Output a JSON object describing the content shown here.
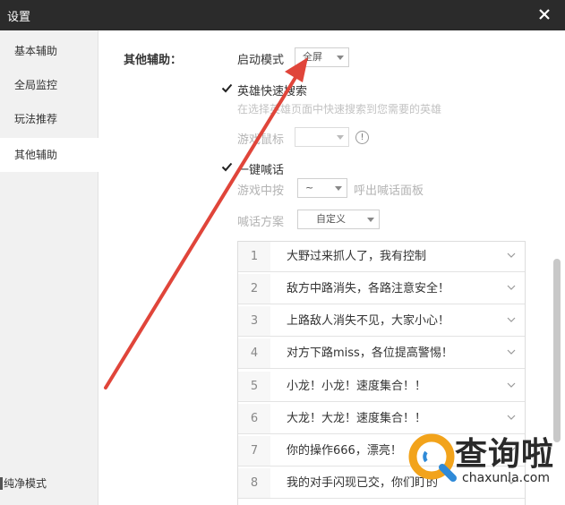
{
  "window": {
    "title": "设置"
  },
  "sidebar": {
    "items": [
      {
        "label": "基本辅助"
      },
      {
        "label": "全局监控"
      },
      {
        "label": "玩法推荐"
      },
      {
        "label": "其他辅助"
      }
    ],
    "active_index": 3,
    "bottom_label": "纯净模式"
  },
  "main": {
    "section_label": "其他辅助：",
    "launch_mode": {
      "label": "启动模式",
      "value": "全屏"
    },
    "hero_search": {
      "checked": true,
      "label": "英雄快速搜索",
      "hint": "在选择英雄页面中快速搜索到您需要的英雄"
    },
    "game_mouse": {
      "label": "游戏鼠标",
      "value": "",
      "info": "!"
    },
    "shout": {
      "checked": true,
      "label": "一键喊话",
      "key_label": "游戏中按",
      "key_value": "~",
      "key_suffix": "呼出喊话面板",
      "scheme_label": "喊话方案",
      "scheme_value": "自定义"
    },
    "phrases": [
      {
        "num": "1",
        "text": "大野过来抓人了，我有控制"
      },
      {
        "num": "2",
        "text": "敌方中路消失，各路注意安全！"
      },
      {
        "num": "3",
        "text": "上路敌人消失不见，大家小心！"
      },
      {
        "num": "4",
        "text": "对方下路miss，各位提高警惕！"
      },
      {
        "num": "5",
        "text": "小龙！小龙！速度集合！！"
      },
      {
        "num": "6",
        "text": "大龙！大龙！速度集合！！"
      },
      {
        "num": "7",
        "text": "你的操作666，漂亮！"
      },
      {
        "num": "8",
        "text": "我的对手闪现已交，你们盯的"
      }
    ]
  },
  "watermark": {
    "brand": "查询啦",
    "site": "chaxunla.com"
  },
  "colors": {
    "titlebar": "#2b2b2b",
    "arrow": "#e0453a",
    "watermark_orange": "#f2a31b",
    "watermark_blue": "#2f8ad8"
  }
}
